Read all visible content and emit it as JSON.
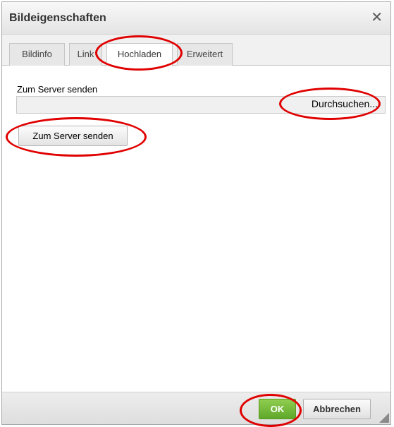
{
  "dialog": {
    "title": "Bildeigenschaften",
    "close_symbol": "✕"
  },
  "tabs": [
    {
      "label": "Bildinfo",
      "active": false
    },
    {
      "label": "Link",
      "active": false
    },
    {
      "label": "Hochladen",
      "active": true
    },
    {
      "label": "Erweitert",
      "active": false
    }
  ],
  "upload": {
    "field_label": "Zum Server senden",
    "browse_label": "Durchsuchen...",
    "send_button_label": "Zum Server senden"
  },
  "footer": {
    "ok_label": "OK",
    "cancel_label": "Abbrechen"
  },
  "colors": {
    "annotation": "#e00000",
    "ok_green": "#6ab532"
  }
}
